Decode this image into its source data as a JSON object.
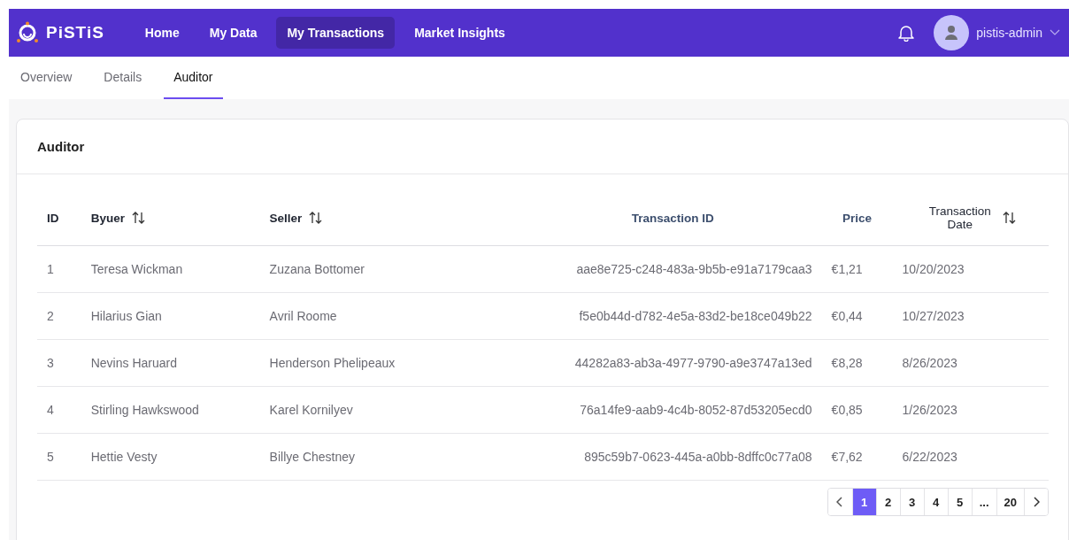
{
  "navbar": {
    "brand": "PiSTiS",
    "items": [
      {
        "label": "Home",
        "selected": false
      },
      {
        "label": "My Data",
        "selected": false
      },
      {
        "label": "My Transactions",
        "selected": true
      },
      {
        "label": "Market Insights",
        "selected": false
      }
    ],
    "user": "pistis-admin"
  },
  "tabs": [
    {
      "label": "Overview",
      "selected": false
    },
    {
      "label": "Details",
      "selected": false
    },
    {
      "label": "Auditor",
      "selected": true
    }
  ],
  "card": {
    "title": "Auditor",
    "table": {
      "columns": [
        {
          "label": "ID",
          "sortable": false,
          "color": "#1f2430"
        },
        {
          "label": "Byuer",
          "sortable": true,
          "color": "#1f2430"
        },
        {
          "label": "Seller",
          "sortable": true,
          "color": "#1f2430"
        },
        {
          "label": "Transaction ID",
          "sortable": false,
          "color": "#3d4f6e"
        },
        {
          "label": "Price",
          "sortable": false,
          "color": "#3d4f6e"
        },
        {
          "label": "Transaction Date",
          "sortable": true,
          "color": "#1f2430"
        }
      ],
      "rows": [
        [
          "1",
          "Teresa Wickman",
          "Zuzana Bottomer",
          "aae8e725-c248-483a-9b5b-e91a7179caa3",
          "€1,21",
          "10/20/2023"
        ],
        [
          "2",
          "Hilarius Gian",
          "Avril Roome",
          "f5e0b44d-d782-4e5a-83d2-be18ce049b22",
          "€0,44",
          "10/27/2023"
        ],
        [
          "3",
          "Nevins Haruard",
          "Henderson Phelipeaux",
          "44282a83-ab3a-4977-9790-a9e3747a13ed",
          "€8,28",
          "8/26/2023"
        ],
        [
          "4",
          "Stirling Hawkswood",
          "Karel Kornilyev",
          "76a14fe9-aab9-4c4b-8052-87d53205ecd0",
          "€0,85",
          "1/26/2023"
        ],
        [
          "5",
          "Hettie Vesty",
          "Billye Chestney",
          "895c59b7-0623-445a-a0bb-8dffc0c77a08",
          "€7,62",
          "6/22/2023"
        ]
      ]
    },
    "pagination": {
      "pages": [
        {
          "label": "1",
          "selected": true
        },
        {
          "label": "2",
          "selected": false
        },
        {
          "label": "3",
          "selected": false
        },
        {
          "label": "4",
          "selected": false
        },
        {
          "label": "5",
          "selected": false
        },
        {
          "label": "...",
          "selected": false
        },
        {
          "label": "20",
          "selected": false
        }
      ]
    }
  }
}
